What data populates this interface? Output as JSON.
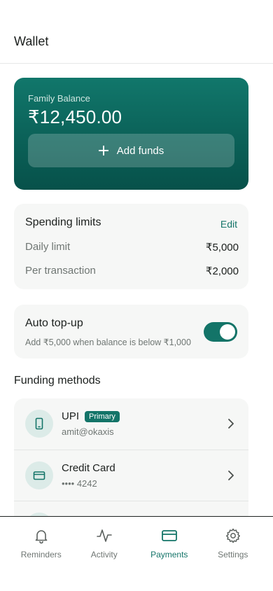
{
  "header": {
    "title": "Wallet"
  },
  "balance": {
    "label": "Family Balance",
    "amount": "₹12,450.00",
    "add_funds_label": "Add funds"
  },
  "limits": {
    "title": "Spending limits",
    "edit_label": "Edit",
    "rows": [
      {
        "label": "Daily limit",
        "value": "₹5,000"
      },
      {
        "label": "Per transaction",
        "value": "₹2,000"
      }
    ]
  },
  "auto_topup": {
    "title": "Auto top-up",
    "description": "Add ₹5,000 when balance is below ₹1,000",
    "enabled": true
  },
  "funding": {
    "title": "Funding methods",
    "methods": [
      {
        "name": "UPI",
        "badge": "Primary",
        "detail": "amit@okaxis",
        "icon": "phone-icon"
      },
      {
        "name": "Credit Card",
        "detail": "•••• 4242",
        "icon": "credit-card-icon"
      }
    ]
  },
  "tabs": [
    {
      "label": "Reminders",
      "icon": "bell-icon"
    },
    {
      "label": "Activity",
      "icon": "activity-icon"
    },
    {
      "label": "Payments",
      "icon": "credit-card-icon",
      "active": true
    },
    {
      "label": "Settings",
      "icon": "gear-icon"
    }
  ],
  "colors": {
    "accent": "#137468",
    "card_bg": "#f6f7f6",
    "balance_gradient_top": "#11776b",
    "balance_gradient_bottom": "#07514a"
  }
}
